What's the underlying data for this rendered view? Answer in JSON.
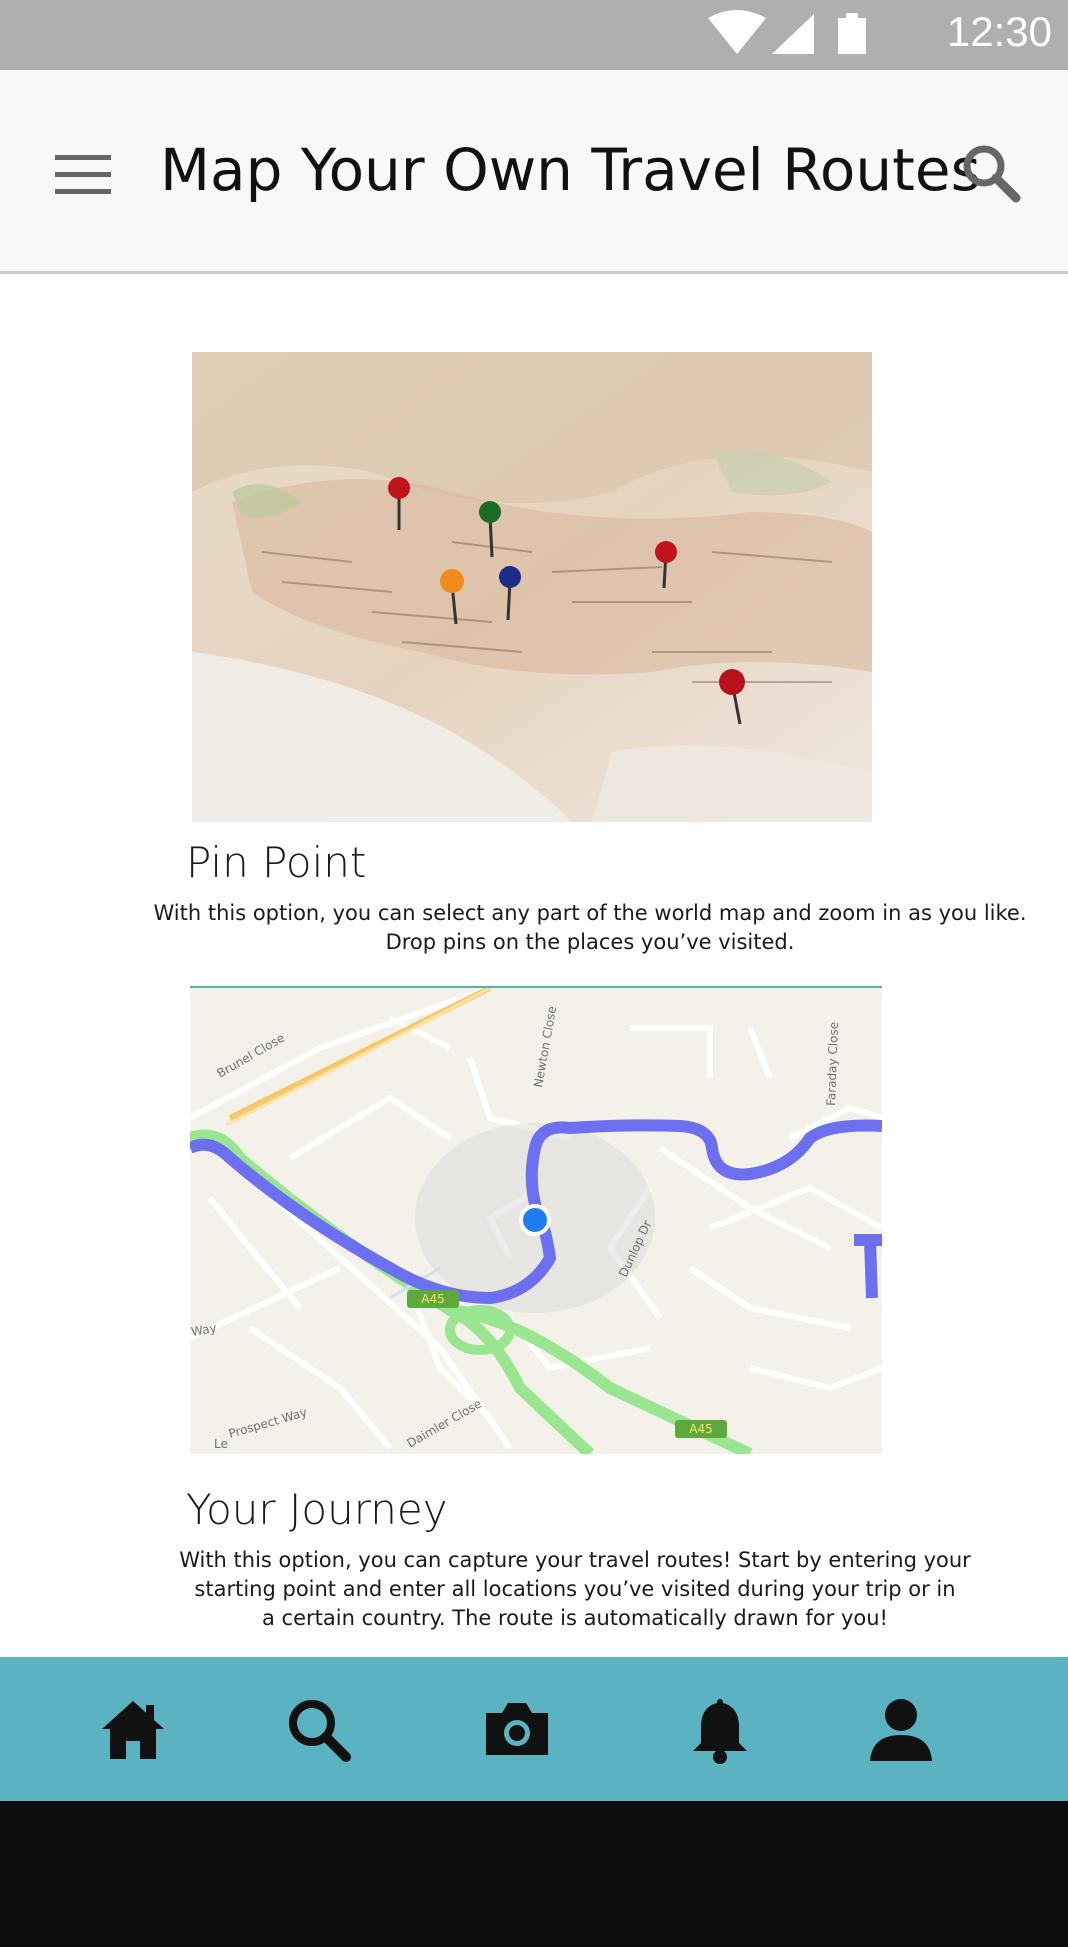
{
  "status_bar": {
    "time": "12:30",
    "icons": [
      "wifi-icon",
      "signal-icon",
      "battery-icon"
    ]
  },
  "header": {
    "title": "Map Your Own Travel Routes",
    "menu_icon": "menu-icon",
    "search_icon": "search-icon"
  },
  "features": [
    {
      "heading": "Pin Point",
      "description_lines": [
        "With this option, you can select any part of the world map and zoom in as you like.",
        "Drop pins on the places you’ve visited."
      ],
      "image": "world-map-with-pins"
    },
    {
      "heading": "Your Journey",
      "description_lines": [
        "With this option, you can capture your travel routes! Start by entering  your",
        "starting point and enter all locations you’ve visited during your trip or in",
        "a certain country. The route is automatically drawn for you!"
      ],
      "image": "route-map",
      "map_labels": {
        "street_1": "Brunel Close",
        "street_2": "Newton Close",
        "street_3": "Faraday Close",
        "street_4": "Dunlop Dr",
        "street_5": "Way",
        "street_6": "Prospect Way",
        "street_7": "Daimler Close",
        "road_1": "A45",
        "road_2": "A45",
        "street_8": "Le"
      }
    }
  ],
  "bottom_nav": {
    "items": [
      "home-icon",
      "search-icon",
      "camera-icon",
      "bell-icon",
      "profile-icon"
    ]
  },
  "colors": {
    "status_bar": "#afafaf",
    "header_bg": "#f8f8f8",
    "nav_bg": "#5bb2c1",
    "route_blue": "#6b6ff0",
    "road_green": "#8fe08a",
    "system_bar": "#0d0d0d"
  }
}
